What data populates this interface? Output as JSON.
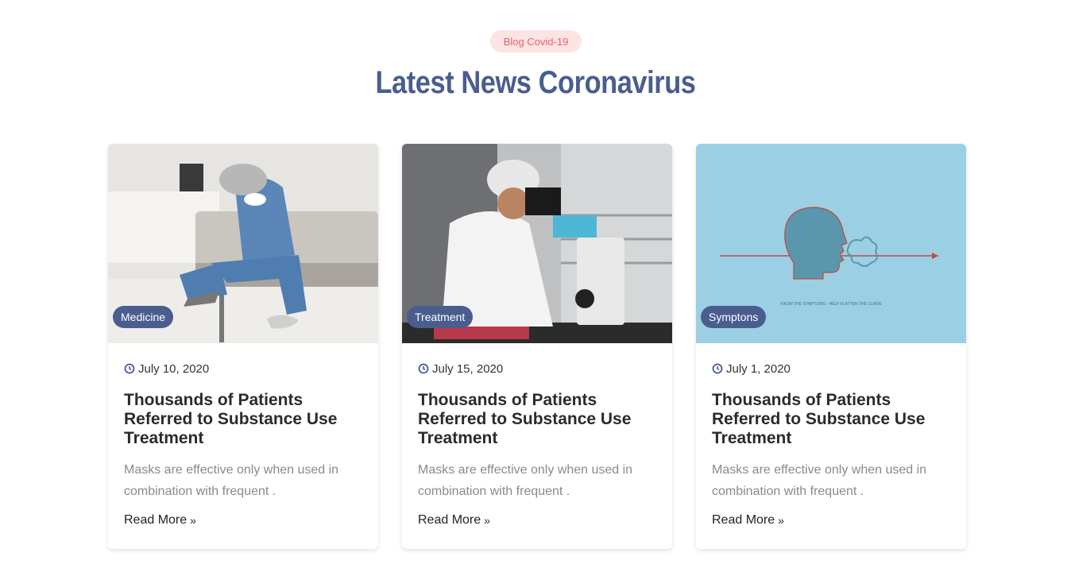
{
  "section": {
    "tag": "Blog Covid-19",
    "title": "Latest News Coronavirus"
  },
  "posts": [
    {
      "category": "Medicine",
      "date": "July 10, 2020",
      "title": "Thousands of Patients Referred to Substance Use Treatment",
      "excerpt": "Masks are effective only when used in combination with frequent .",
      "read_more": "Read More",
      "image_icon": "tired-doctor-photo"
    },
    {
      "category": "Treatment",
      "date": "July 15, 2020",
      "title": "Thousands of Patients Referred to Substance Use Treatment",
      "excerpt": "Masks are effective only when used in combination with frequent .",
      "read_more": "Read More",
      "image_icon": "lab-microscope-photo"
    },
    {
      "category": "Symptons",
      "date": "July 1, 2020",
      "title": "Thousands of Patients Referred to Substance Use Treatment",
      "excerpt": "Masks are effective only when used in combination with frequent .",
      "read_more": "Read More",
      "image_icon": "cough-illustration",
      "image_caption": "KNOW THE SYMPTOMS - HELP FLATTEN THE CURVE"
    }
  ],
  "colors": {
    "accent": "#4a5d8f",
    "tag_bg": "#fde4e4",
    "tag_text": "#e8616a",
    "illustration_bg": "#9bd0e4"
  }
}
